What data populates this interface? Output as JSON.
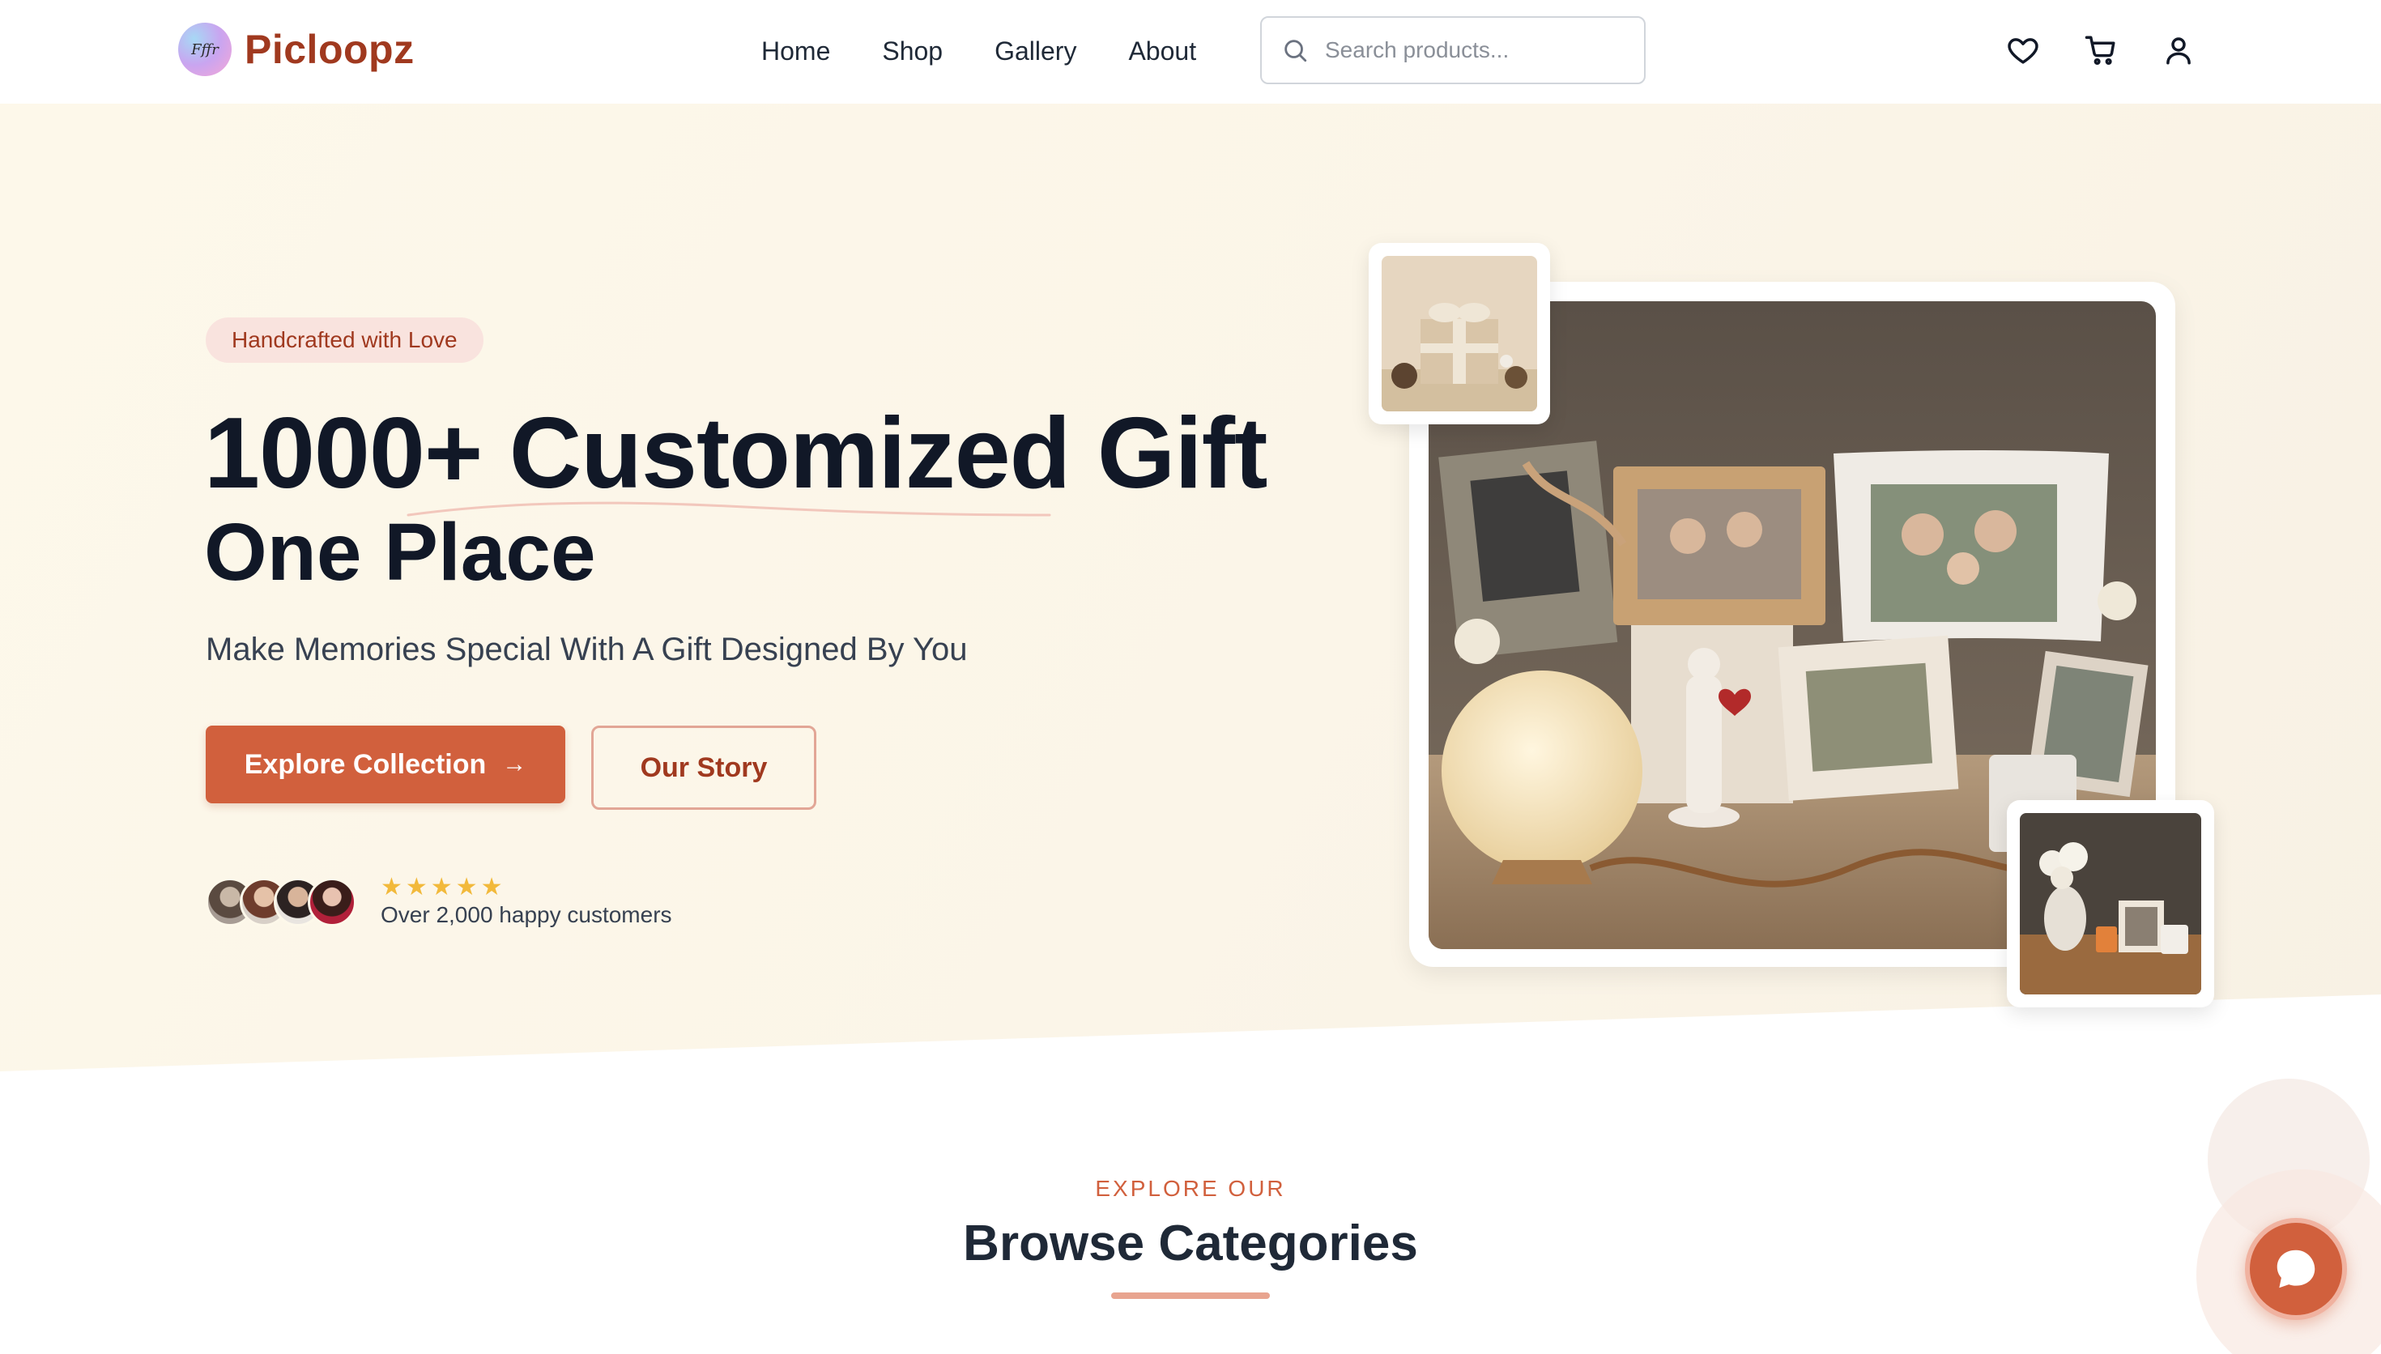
{
  "brand": {
    "name": "Picloopz",
    "logo_text": "Fffr"
  },
  "nav": {
    "items": [
      "Home",
      "Shop",
      "Gallery",
      "About"
    ]
  },
  "search": {
    "placeholder": "Search products..."
  },
  "header_icons": [
    "heart-icon",
    "cart-icon",
    "user-icon"
  ],
  "hero": {
    "badge": "Handcrafted with Love",
    "title_line1": "1000+ Customized Gift",
    "title_line2": "One Place",
    "subtitle": "Make Memories Special With A Gift Designed By You",
    "primary_button": "Explore Collection",
    "secondary_button": "Our Story",
    "rating_stars": "★★★★★",
    "rating_value": 5,
    "customers_text": "Over 2,000 happy customers"
  },
  "categories": {
    "eyebrow": "EXPLORE OUR",
    "title": "Browse Categories"
  },
  "colors": {
    "brand": "#a0391f",
    "accent": "#d1603d",
    "hero_bg": "#fdf8ea",
    "badge_bg": "#f9e3de",
    "star": "#f2b93b"
  }
}
